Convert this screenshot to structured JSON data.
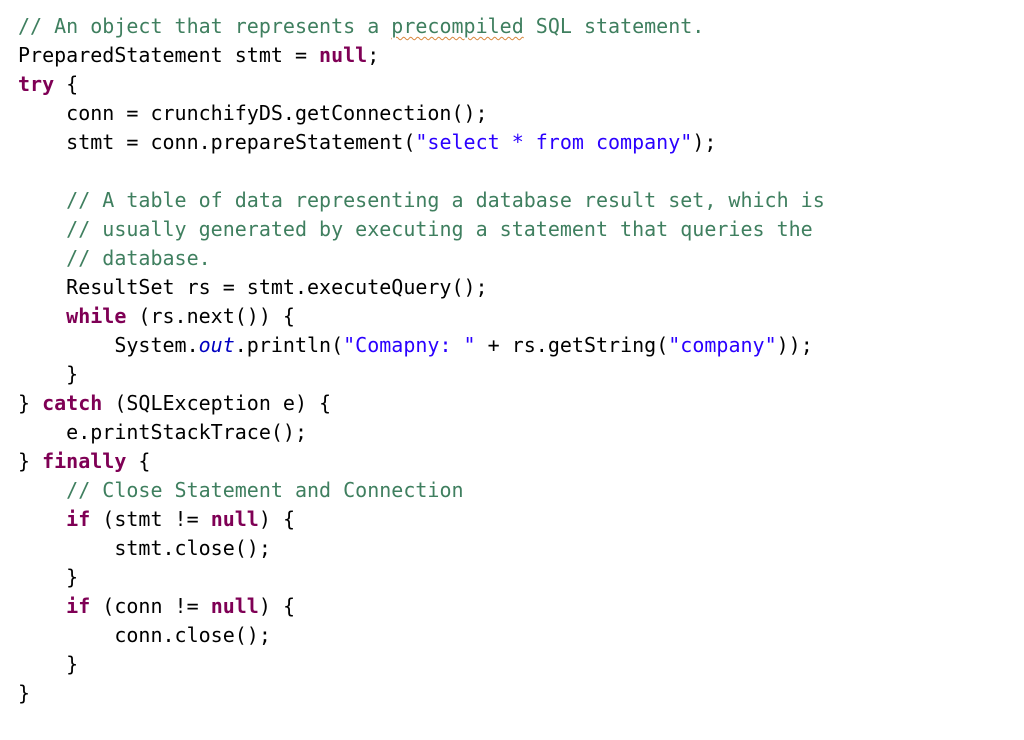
{
  "code": {
    "l01": {
      "a": "// An object that represents a ",
      "b": "precompiled",
      "c": " SQL statement."
    },
    "l02": {
      "a": "PreparedStatement stmt = ",
      "b": "null",
      "c": ";"
    },
    "l03": {
      "a": "try",
      "b": " {"
    },
    "l04": {
      "a": "    conn = crunchifyDS.getConnection();"
    },
    "l05": {
      "a": "    stmt = conn.prepareStatement(",
      "b": "\"select * from company\"",
      "c": ");"
    },
    "l06": {
      "a": ""
    },
    "l07": {
      "a": "    ",
      "b": "// A table of data representing a database result set, which is"
    },
    "l08": {
      "a": "    ",
      "b": "// usually generated by executing a statement that queries the"
    },
    "l09": {
      "a": "    ",
      "b": "// database."
    },
    "l10": {
      "a": "    ResultSet rs = stmt.executeQuery();"
    },
    "l11": {
      "a": "    ",
      "b": "while",
      "c": " (rs.next()) {"
    },
    "l12": {
      "a": "        System.",
      "b": "out",
      "c": ".println(",
      "d": "\"Comapny: \"",
      "e": " + rs.getString(",
      "f": "\"company\"",
      "g": "));"
    },
    "l13": {
      "a": "    }"
    },
    "l14": {
      "a": "} ",
      "b": "catch",
      "c": " (SQLException e) {"
    },
    "l15": {
      "a": "    e.printStackTrace();"
    },
    "l16": {
      "a": "} ",
      "b": "finally",
      "c": " {"
    },
    "l17": {
      "a": "    ",
      "b": "// Close Statement and Connection"
    },
    "l18": {
      "a": "    ",
      "b": "if",
      "c": " (stmt != ",
      "d": "null",
      "e": ") {"
    },
    "l19": {
      "a": "        stmt.close();"
    },
    "l20": {
      "a": "    }"
    },
    "l21": {
      "a": "    ",
      "b": "if",
      "c": " (conn != ",
      "d": "null",
      "e": ") {"
    },
    "l22": {
      "a": "        conn.close();"
    },
    "l23": {
      "a": "    }"
    },
    "l24": {
      "a": "}"
    }
  }
}
